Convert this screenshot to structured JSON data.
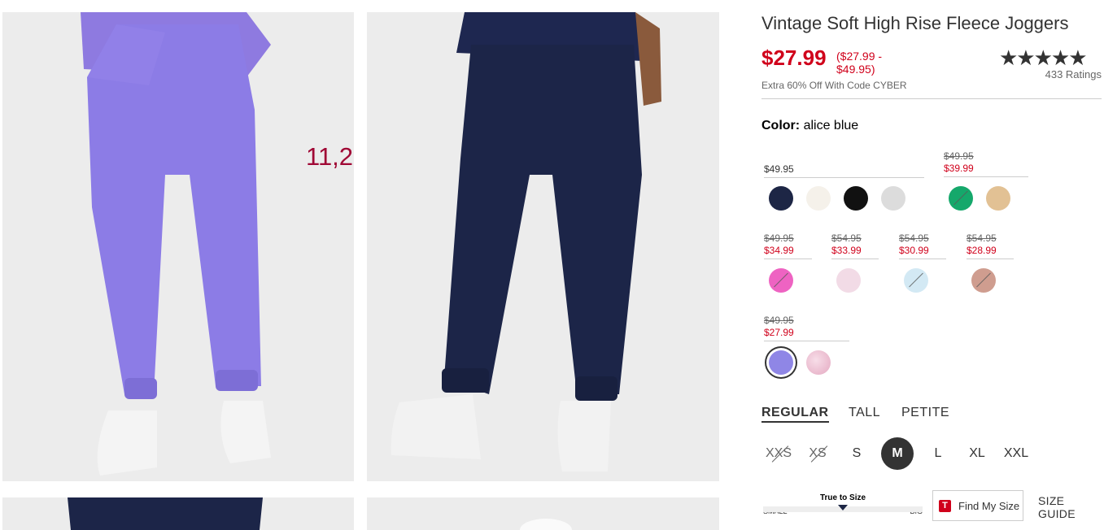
{
  "gallery": {
    "overlay_text": "11,2",
    "images": [
      "purple-joggers-front",
      "navy-joggers-back",
      "navy-joggers-front",
      "white-joggers-front"
    ]
  },
  "product": {
    "title": "Vintage Soft High Rise Fleece Joggers",
    "price": "$27.99",
    "price_range": "($27.99 - $49.95)",
    "promo": "Extra 60% Off With Code CYBER",
    "stars": "★★★★★",
    "rating_value": 4.5,
    "ratings_count": "433 Ratings"
  },
  "color": {
    "label": "Color:",
    "selected": "alice blue",
    "groups": [
      {
        "regular": "$49.95",
        "swatches": [
          {
            "name": "navy",
            "hex": "#1d2645"
          },
          {
            "name": "ivory",
            "hex": "#f5f1ea"
          },
          {
            "name": "black",
            "hex": "#111111"
          },
          {
            "name": "light-heather-gray",
            "hex": "#dcdcdc"
          }
        ]
      },
      {
        "old": "$49.95",
        "new": "$39.99",
        "swatches": [
          {
            "name": "green",
            "hex": "#15a86b",
            "unavailable": true
          },
          {
            "name": "tan",
            "hex": "#e2c194"
          }
        ]
      },
      {
        "old": "$49.95",
        "new": "$34.99",
        "swatches": [
          {
            "name": "pink",
            "hex": "#ee63c2",
            "unavailable": true
          }
        ]
      },
      {
        "old": "$54.95",
        "new": "$33.99",
        "swatches": [
          {
            "name": "light-pink",
            "hex": "#f2dbe6"
          }
        ]
      },
      {
        "old": "$54.95",
        "new": "$30.99",
        "swatches": [
          {
            "name": "light-blue-tie-dye",
            "hex": "#d3e9f4",
            "unavailable": true
          }
        ]
      },
      {
        "old": "$54.95",
        "new": "$28.99",
        "swatches": [
          {
            "name": "rose-brown",
            "hex": "#cf9d8f",
            "unavailable": true
          }
        ]
      },
      {
        "old": "$49.95",
        "new": "$27.99",
        "swatches": [
          {
            "name": "alice-blue",
            "hex": "#8f86e6",
            "selected": true
          },
          {
            "name": "pink-tie-dye",
            "hex": "#ecbccf"
          }
        ]
      }
    ]
  },
  "fit": {
    "options": [
      "REGULAR",
      "TALL",
      "PETITE"
    ],
    "selected": "REGULAR"
  },
  "sizes": [
    {
      "label": "XXS",
      "available": false
    },
    {
      "label": "XS",
      "available": false
    },
    {
      "label": "S",
      "available": true
    },
    {
      "label": "M",
      "available": true,
      "selected": true
    },
    {
      "label": "L",
      "available": true
    },
    {
      "label": "XL",
      "available": true
    },
    {
      "label": "XXL",
      "available": true
    }
  ],
  "true_to_size": {
    "title": "True to Size",
    "small": "SMALL",
    "big": "BIG"
  },
  "find_my_size": {
    "label": "Find My Size",
    "badge": "T"
  },
  "size_guide": "SIZE GUIDE"
}
